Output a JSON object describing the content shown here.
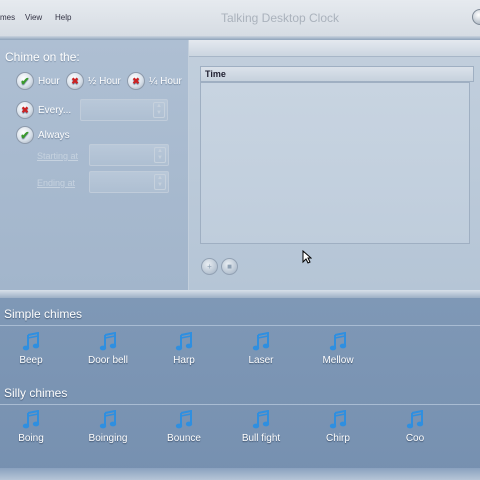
{
  "window": {
    "title": "Talking Desktop Clock",
    "menu": [
      "mes",
      "View",
      "Help"
    ]
  },
  "options": {
    "chime_on_label": "Chime on the:",
    "hour": "Hour",
    "half_hour": "½ Hour",
    "quarter_hour": "¼ Hour",
    "every": "Every...",
    "always": "Always",
    "starting_at": "Starting at",
    "ending_at": "Ending at",
    "states": {
      "hour": true,
      "half_hour": false,
      "quarter_hour": false,
      "every": false,
      "always": true
    }
  },
  "list": {
    "header": "Time"
  },
  "simple_chimes": {
    "title": "Simple chimes",
    "items": [
      "Beep",
      "Door bell",
      "Harp",
      "Laser",
      "Mellow"
    ]
  },
  "silly_chimes": {
    "title": "Silly chimes",
    "items": [
      "Boing",
      "Boinging",
      "Bounce",
      "Bull fight",
      "Chirp",
      "Coo"
    ]
  },
  "colors": {
    "check_green": "#3a9a2c",
    "cross_red": "#cc2222",
    "note_blue": "#2f8fe0"
  },
  "icons": {
    "chime_item": "music-note-icon",
    "checked": "check-icon",
    "unchecked": "cross-icon"
  }
}
